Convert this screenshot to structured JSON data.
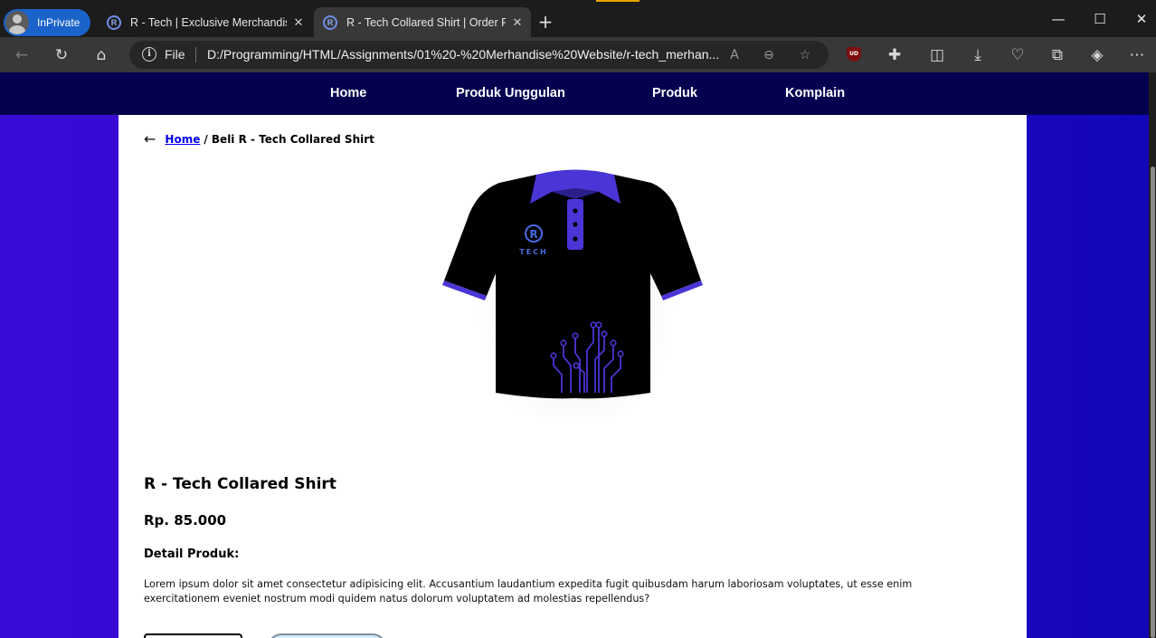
{
  "browser": {
    "inprivate_label": "InPrivate",
    "tabs": [
      {
        "title": "R - Tech | Exclusive Merchandise",
        "favicon": "R"
      },
      {
        "title": "R - Tech Collared Shirt | Order Page",
        "favicon": "R"
      }
    ],
    "address": {
      "scheme": "File",
      "url": "D:/Programming/HTML/Assignments/01%20-%20Merhandise%20Website/r-tech_merhan..."
    },
    "extension_badge": "UD"
  },
  "page": {
    "nav": [
      "Home",
      "Produk Unggulan",
      "Produk",
      "Komplain"
    ],
    "breadcrumb": {
      "home": "Home",
      "current": "/ Beli R - Tech Collared Shirt"
    },
    "shirt_logo_text": "TECH",
    "shirt_logo_letter": "R",
    "product": {
      "title": "R - Tech Collared Shirt",
      "price": "Rp. 85.000",
      "detail_label": "Detail Produk:",
      "description": "Lorem ipsum dolor sit amet consectetur adipisicing elit. Accusantium laudantium expedita fugit quibusdam harum laboriosam voluptates, ut esse enim exercitationem eveniet nostrum modi quidem natus dolorum voluptatem ad molestias repellendus?"
    }
  },
  "colors": {
    "navbar": "#03004f",
    "page_gradient_left": "#3b0bd6",
    "page_gradient_right": "#1206b9",
    "shirt_body": "#000000",
    "shirt_accent": "#4a35d6"
  }
}
